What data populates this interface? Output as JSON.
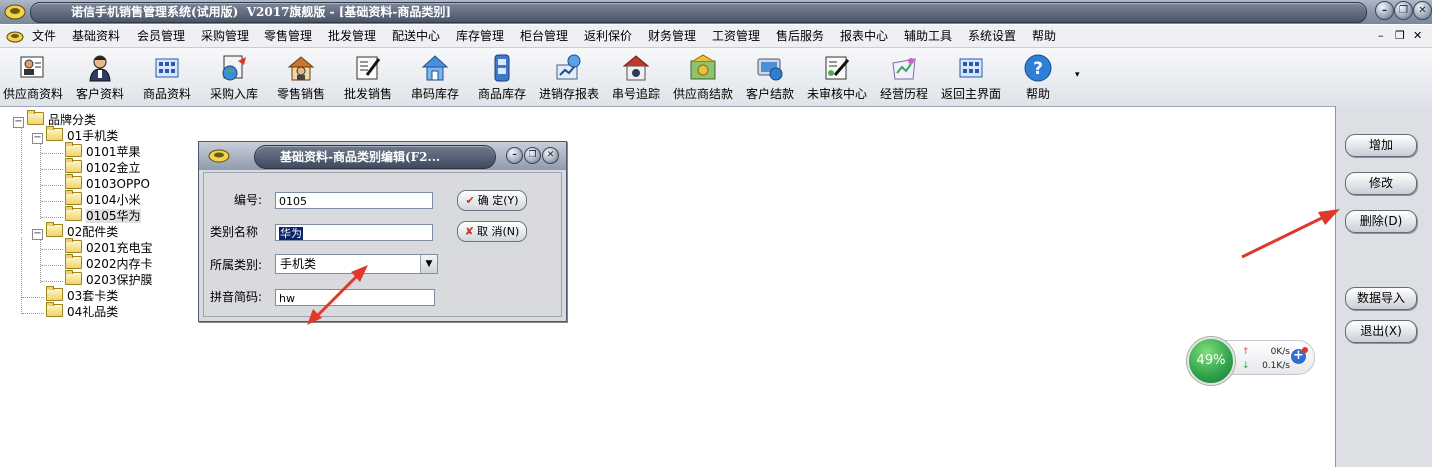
{
  "window": {
    "title": "诺信手机销售管理系统(试用版)  V2017旗舰版 - [基础资料-商品类别]",
    "minimize_glyph": "–",
    "restore_glyph": "❐",
    "close_glyph": "✕"
  },
  "menu": {
    "items": [
      "文件",
      "基础资料",
      "会员管理",
      "采购管理",
      "零售管理",
      "批发管理",
      "配送中心",
      "库存管理",
      "柜台管理",
      "返利保价",
      "财务管理",
      "工资管理",
      "售后服务",
      "报表中心",
      "辅助工具",
      "系统设置",
      "帮助"
    ],
    "mdi_minimize": "–",
    "mdi_restore": "❐",
    "mdi_close": "✕"
  },
  "toolbar": {
    "items": [
      {
        "label": "供应商资料",
        "icon": "supplier-icon"
      },
      {
        "label": "客户资料",
        "icon": "customer-icon"
      },
      {
        "label": "商品资料",
        "icon": "product-icon"
      },
      {
        "label": "采购入库",
        "icon": "purchase-icon"
      },
      {
        "label": "零售销售",
        "icon": "retail-icon"
      },
      {
        "label": "批发销售",
        "icon": "wholesale-icon"
      },
      {
        "label": "串码库存",
        "icon": "serial-stock-icon"
      },
      {
        "label": "商品库存",
        "icon": "product-stock-icon"
      },
      {
        "label": "进销存报表",
        "icon": "report-icon"
      },
      {
        "label": "串号追踪",
        "icon": "serial-trace-icon"
      },
      {
        "label": "供应商结款",
        "icon": "supplier-payment-icon"
      },
      {
        "label": "客户结款",
        "icon": "customer-payment-icon"
      },
      {
        "label": "未审核中心",
        "icon": "unaudited-icon"
      },
      {
        "label": "经营历程",
        "icon": "history-icon"
      },
      {
        "label": "返回主界面",
        "icon": "home-icon"
      },
      {
        "label": "帮助",
        "icon": "help-icon"
      }
    ],
    "more_glyph": "▾"
  },
  "tree": {
    "root": "品牌分类",
    "groups": [
      {
        "label": "01手机类",
        "children": [
          "0101苹果",
          "0102金立",
          "0103OPPO",
          "0104小米",
          "0105华为"
        ]
      },
      {
        "label": "02配件类",
        "children": [
          "0201充电宝",
          "0202内存卡",
          "0203保护膜"
        ]
      },
      {
        "label": "03套卡类",
        "children": []
      },
      {
        "label": "04礼品类",
        "children": []
      }
    ],
    "expanded_glyph": "−"
  },
  "dialog": {
    "title": "基础资料-商品类别编辑(F2...",
    "fields": {
      "code_label": "编号:",
      "code_value": "0105",
      "name_label": "类别名称",
      "name_value": "华为",
      "parent_label": "所属类别:",
      "parent_value": "手机类",
      "pinyin_label": "拼音简码:",
      "pinyin_value": "hw"
    },
    "ok_label": "确 定(Y)",
    "cancel_label": "取 消(N)",
    "ok_glyph": "✔",
    "cancel_glyph": "✘",
    "dropdown_glyph": "▼",
    "minimize_glyph": "–",
    "restore_glyph": "❐",
    "close_glyph": "✕"
  },
  "side_buttons": [
    "增加",
    "修改",
    "删除(D)",
    "数据导入",
    "退出(X)"
  ],
  "speed_widget": {
    "percent": "49%",
    "upload": "0K/s",
    "download": "0.1K/s",
    "up_glyph": "↑",
    "down_glyph": "↓",
    "plus_glyph": "+"
  },
  "colors": {
    "arrow": "#e0392b",
    "selection": "#0a246a",
    "gauge": "#2fa04a"
  }
}
